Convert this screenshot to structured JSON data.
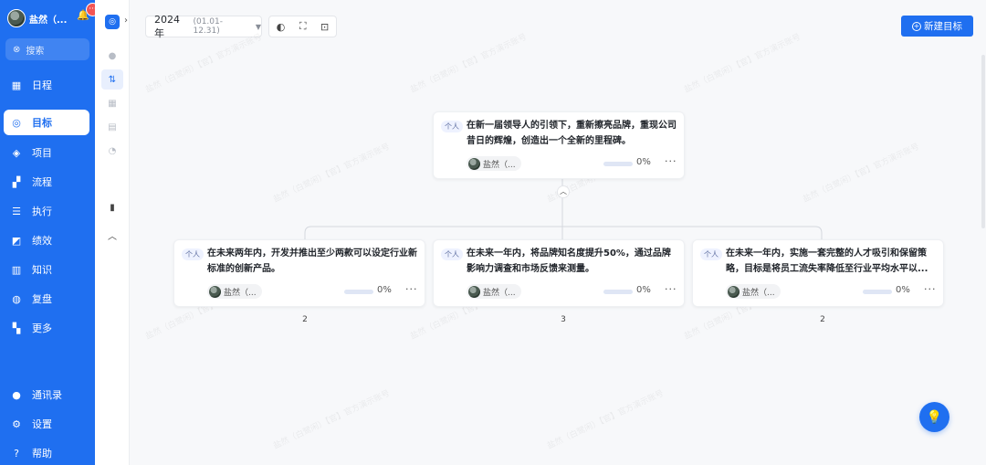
{
  "user": {
    "name": "盐然（...",
    "badge": "···"
  },
  "search": {
    "placeholder": "搜索"
  },
  "nav": [
    {
      "key": "schedule",
      "label": "日程",
      "icon": "calendar-icon"
    },
    {
      "key": "goals",
      "label": "目标",
      "icon": "target-icon",
      "active": true
    },
    {
      "key": "projects",
      "label": "项目",
      "icon": "cube-icon"
    },
    {
      "key": "process",
      "label": "流程",
      "icon": "flow-icon"
    },
    {
      "key": "execute",
      "label": "执行",
      "icon": "checklist-icon"
    },
    {
      "key": "performance",
      "label": "绩效",
      "icon": "chart-icon"
    },
    {
      "key": "knowledge",
      "label": "知识",
      "icon": "book-icon"
    },
    {
      "key": "review",
      "label": "复盘",
      "icon": "review-icon"
    },
    {
      "key": "more",
      "label": "更多",
      "icon": "grid-plus-icon"
    }
  ],
  "nav_bottom": [
    {
      "key": "contacts",
      "label": "通讯录",
      "icon": "contacts-icon"
    },
    {
      "key": "settings",
      "label": "设置",
      "icon": "gear-icon"
    },
    {
      "key": "help",
      "label": "帮助",
      "icon": "question-icon"
    }
  ],
  "toolbar": {
    "year": "2024年",
    "range": "(01.01-12.31)",
    "new_goal": "新建目标"
  },
  "watermark": "盐然（白鹭闲）【官】官方演示账号",
  "root_card": {
    "tag": "个人",
    "text": "在新一届领导人的引领下，重新擦亮品牌，重现公司昔日的辉煌，创造出一个全新的里程碑。",
    "owner": "盐然（...",
    "progress": 0,
    "progress_label": "0%"
  },
  "child_cards": [
    {
      "tag": "个人",
      "text": "在未来两年内，开发并推出至少两款可以设定行业新标准的创新产品。",
      "owner": "盐然（...",
      "progress": 0,
      "progress_label": "0%",
      "count": "2"
    },
    {
      "tag": "个人",
      "text": "在未来一年内，将品牌知名度提升50%，通过品牌影响力调查和市场反馈来测量。",
      "owner": "盐然（...",
      "progress": 0,
      "progress_label": "0%",
      "count": "3"
    },
    {
      "tag": "个人",
      "text": "在未来一年内，实施一套完整的人才吸引和保留策略，目标是将员工流失率降低至行业平均水平以...",
      "owner": "盐然（...",
      "progress": 0,
      "progress_label": "0%",
      "count": "2"
    }
  ]
}
